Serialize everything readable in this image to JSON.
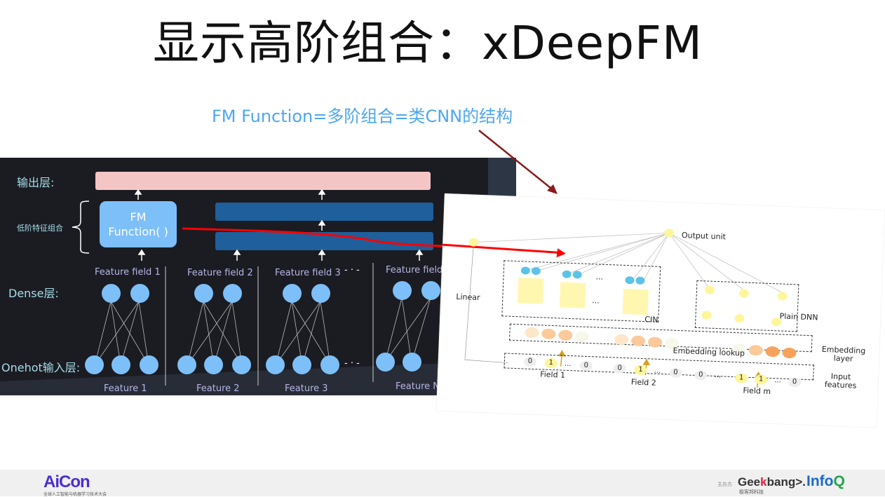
{
  "slide": {
    "title": "显示高阶组合：xDeepFM",
    "subtitle": "FM Function=多阶组合=类CNN的结构",
    "colors": {
      "subtitle": "#4da6ee",
      "annotation_arrow": "#8b1a1a",
      "red_line": "#ff0000"
    }
  },
  "left_diagram": {
    "layer_labels": {
      "output": "输出层:",
      "low_order": "低阶特征组合",
      "dense": "Dense层:",
      "onehot": "Onehot输入层:"
    },
    "fm_box": {
      "line1": "FM",
      "line2": "Function( )"
    },
    "feature_fields": [
      "Feature field 1",
      "Feature field 2",
      "Feature field 3",
      "Feature field N"
    ],
    "features": [
      "Feature 1",
      "Feature 2",
      "Feature 3",
      "Feature N"
    ],
    "ellipsis": "- · -"
  },
  "right_diagram": {
    "output_unit": "Output unit",
    "linear": "Linear",
    "cin": "CIN",
    "plain_dnn": "Plain DNN",
    "embedding_lookup": "Embedding lookup",
    "embedding_layer": [
      "Embedding",
      "layer"
    ],
    "input_features": [
      "Input",
      "features"
    ],
    "fields": [
      "Field 1",
      "Field 2",
      "Field m"
    ],
    "field1_bits": [
      "0",
      "1",
      "...",
      "0"
    ],
    "field2_bits": [
      "0",
      "1",
      "...",
      "0"
    ],
    "fieldm_bits": [
      "1",
      "1",
      "...",
      "0"
    ],
    "middle_bits": [
      "0",
      "..."
    ],
    "dots": "..."
  },
  "footer": {
    "aicon_logo": "AiCon",
    "aicon_sub": "全球人工智能与机器学习技术大会",
    "sponsor_label": "主办方",
    "geekbang_logo_a": "Gee",
    "geekbang_logo_k": "k",
    "geekbang_logo_b": "bang>.",
    "geekbang_sub": "极客邦科技",
    "infoq_logo_a": "Info",
    "infoq_logo_q": "Q"
  }
}
